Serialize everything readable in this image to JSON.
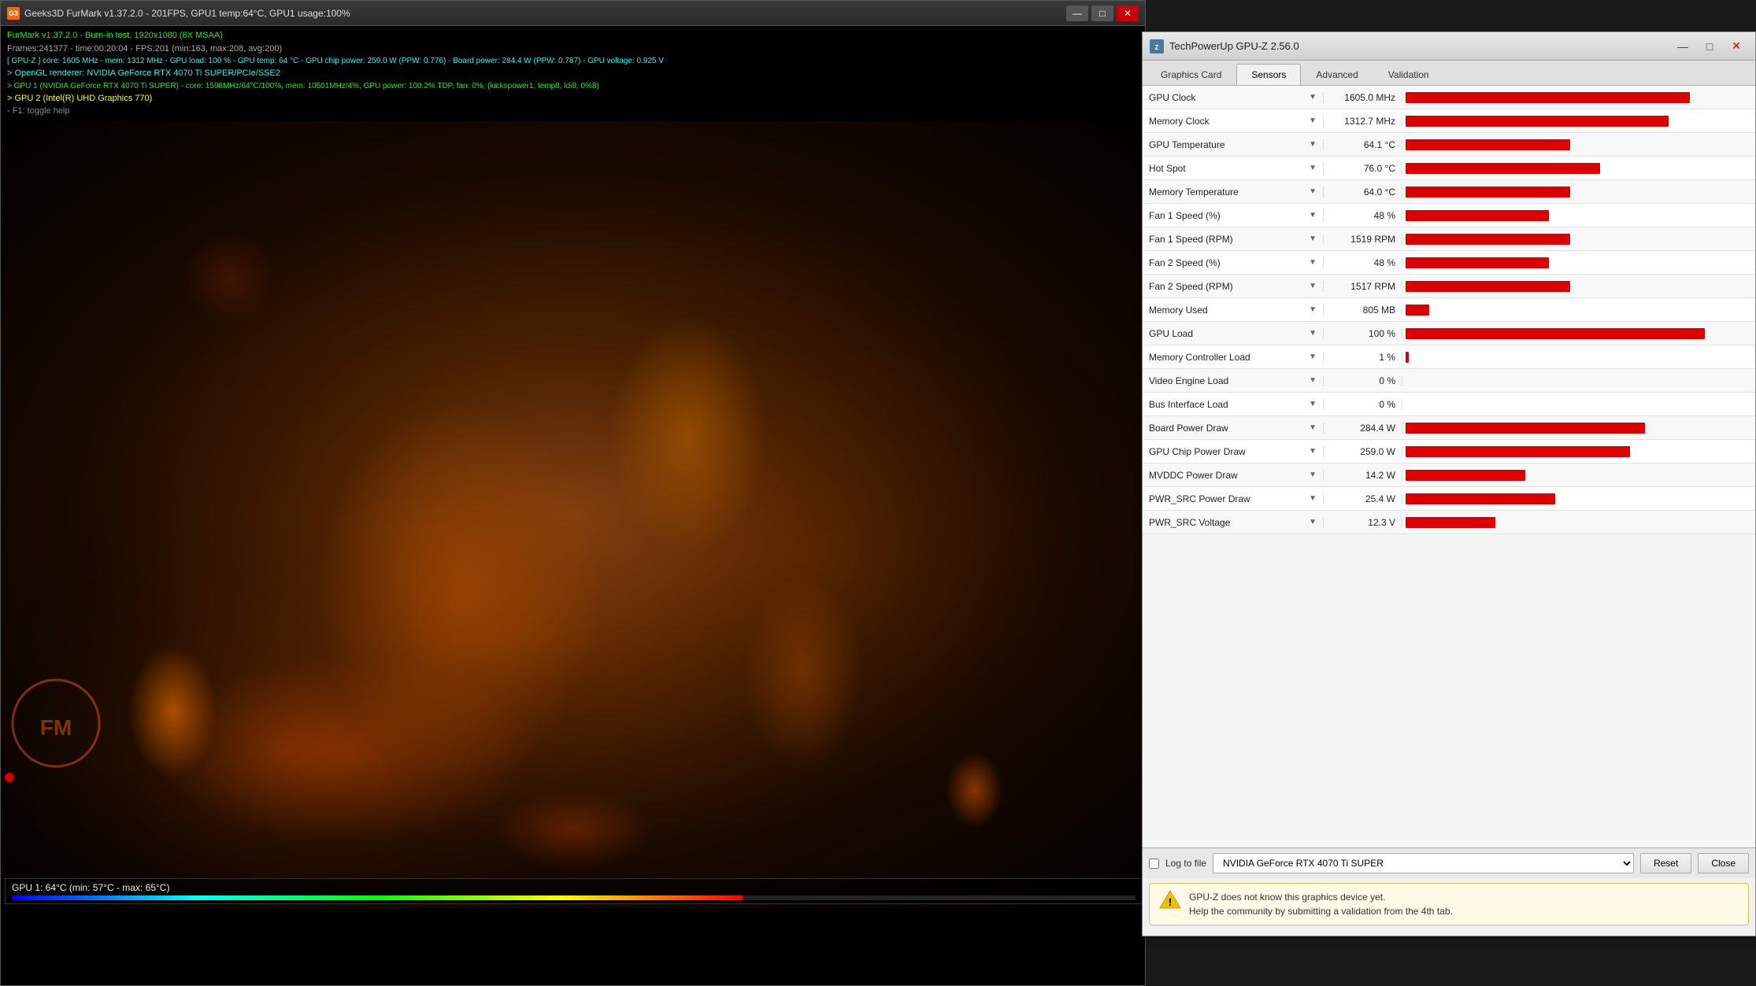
{
  "furmark": {
    "title": "Geeks3D FurMark v1.37.2.0 - 201FPS, GPU1 temp:64°C, GPU1 usage:100%",
    "icon": "G3",
    "line1": "FurMark v1.37.2.0 - Burn-in test, 1920x1080 (8X MSAA)",
    "line2": "Frames:241377 - time:00:20:04 - FPS:201 (min:163, max:208, avg:200)",
    "line3": "[ GPU-Z ] core: 1605 MHz - mem: 1312 MHz - GPU load: 100 % - GPU temp: 64 °C - GPU chip power: 259.0 W (PPW: 0.776) - Board power: 284.4 W (PPW: 0.787) - GPU voltage: 0.925 V",
    "line4": "> OpenGL renderer: NVIDIA GeForce RTX 4070 Ti SUPER/PCIe/SSE2",
    "line5": "> GPU 1 (NVIDIA GeForce RTX 4070 Ti SUPER) - core: 1598MHz/64°C/100%, mem: 10501MHz/4%, GPU power: 100.2% TDP, fan: 0%, (kickspower1, temp8, ldi8, 0%8)",
    "line6": "> GPU 2 (Intel(R) UHD Graphics 770)",
    "line7": "- F1: toggle help",
    "gpu_temp": "GPU 1: 64°C (min: 57°C - max: 65°C)"
  },
  "gpuz": {
    "title": "TechPowerUp GPU-Z 2.56.0",
    "tabs": [
      "Graphics Card",
      "Sensors",
      "Advanced",
      "Validation"
    ],
    "active_tab": "Sensors",
    "sensors": [
      {
        "name": "GPU Clock",
        "value": "1605.0 MHz",
        "bar_pct": 95
      },
      {
        "name": "Memory Clock",
        "value": "1312.7 MHz",
        "bar_pct": 88
      },
      {
        "name": "GPU Temperature",
        "value": "64.1 °C",
        "bar_pct": 55
      },
      {
        "name": "Hot Spot",
        "value": "76.0 °C",
        "bar_pct": 65
      },
      {
        "name": "Memory Temperature",
        "value": "64.0 °C",
        "bar_pct": 55
      },
      {
        "name": "Fan 1 Speed (%)",
        "value": "48 %",
        "bar_pct": 48
      },
      {
        "name": "Fan 1 Speed (RPM)",
        "value": "1519 RPM",
        "bar_pct": 55
      },
      {
        "name": "Fan 2 Speed (%)",
        "value": "48 %",
        "bar_pct": 48
      },
      {
        "name": "Fan 2 Speed (RPM)",
        "value": "1517 RPM",
        "bar_pct": 55
      },
      {
        "name": "Memory Used",
        "value": "805 MB",
        "bar_pct": 8
      },
      {
        "name": "GPU Load",
        "value": "100 %",
        "bar_pct": 100
      },
      {
        "name": "Memory Controller Load",
        "value": "1 %",
        "bar_pct": 1
      },
      {
        "name": "Video Engine Load",
        "value": "0 %",
        "bar_pct": 0
      },
      {
        "name": "Bus Interface Load",
        "value": "0 %",
        "bar_pct": 0
      },
      {
        "name": "Board Power Draw",
        "value": "284.4 W",
        "bar_pct": 80
      },
      {
        "name": "GPU Chip Power Draw",
        "value": "259.0 W",
        "bar_pct": 75
      },
      {
        "name": "MVDDC Power Draw",
        "value": "14.2 W",
        "bar_pct": 40
      },
      {
        "name": "PWR_SRC Power Draw",
        "value": "25.4 W",
        "bar_pct": 50
      },
      {
        "name": "PWR_SRC Voltage",
        "value": "12.3 V",
        "bar_pct": 30
      }
    ],
    "gpu_selector": "NVIDIA GeForce RTX 4070 Ti SUPER",
    "log_to_file_label": "Log to file",
    "reset_btn": "Reset",
    "close_btn": "Close",
    "notification": "GPU-Z does not know this graphics device yet.\nHelp the community by submitting a validation from the 4th tab.",
    "titlebar_btns": {
      "minimize": "—",
      "maximize": "□",
      "close": "✕"
    }
  }
}
